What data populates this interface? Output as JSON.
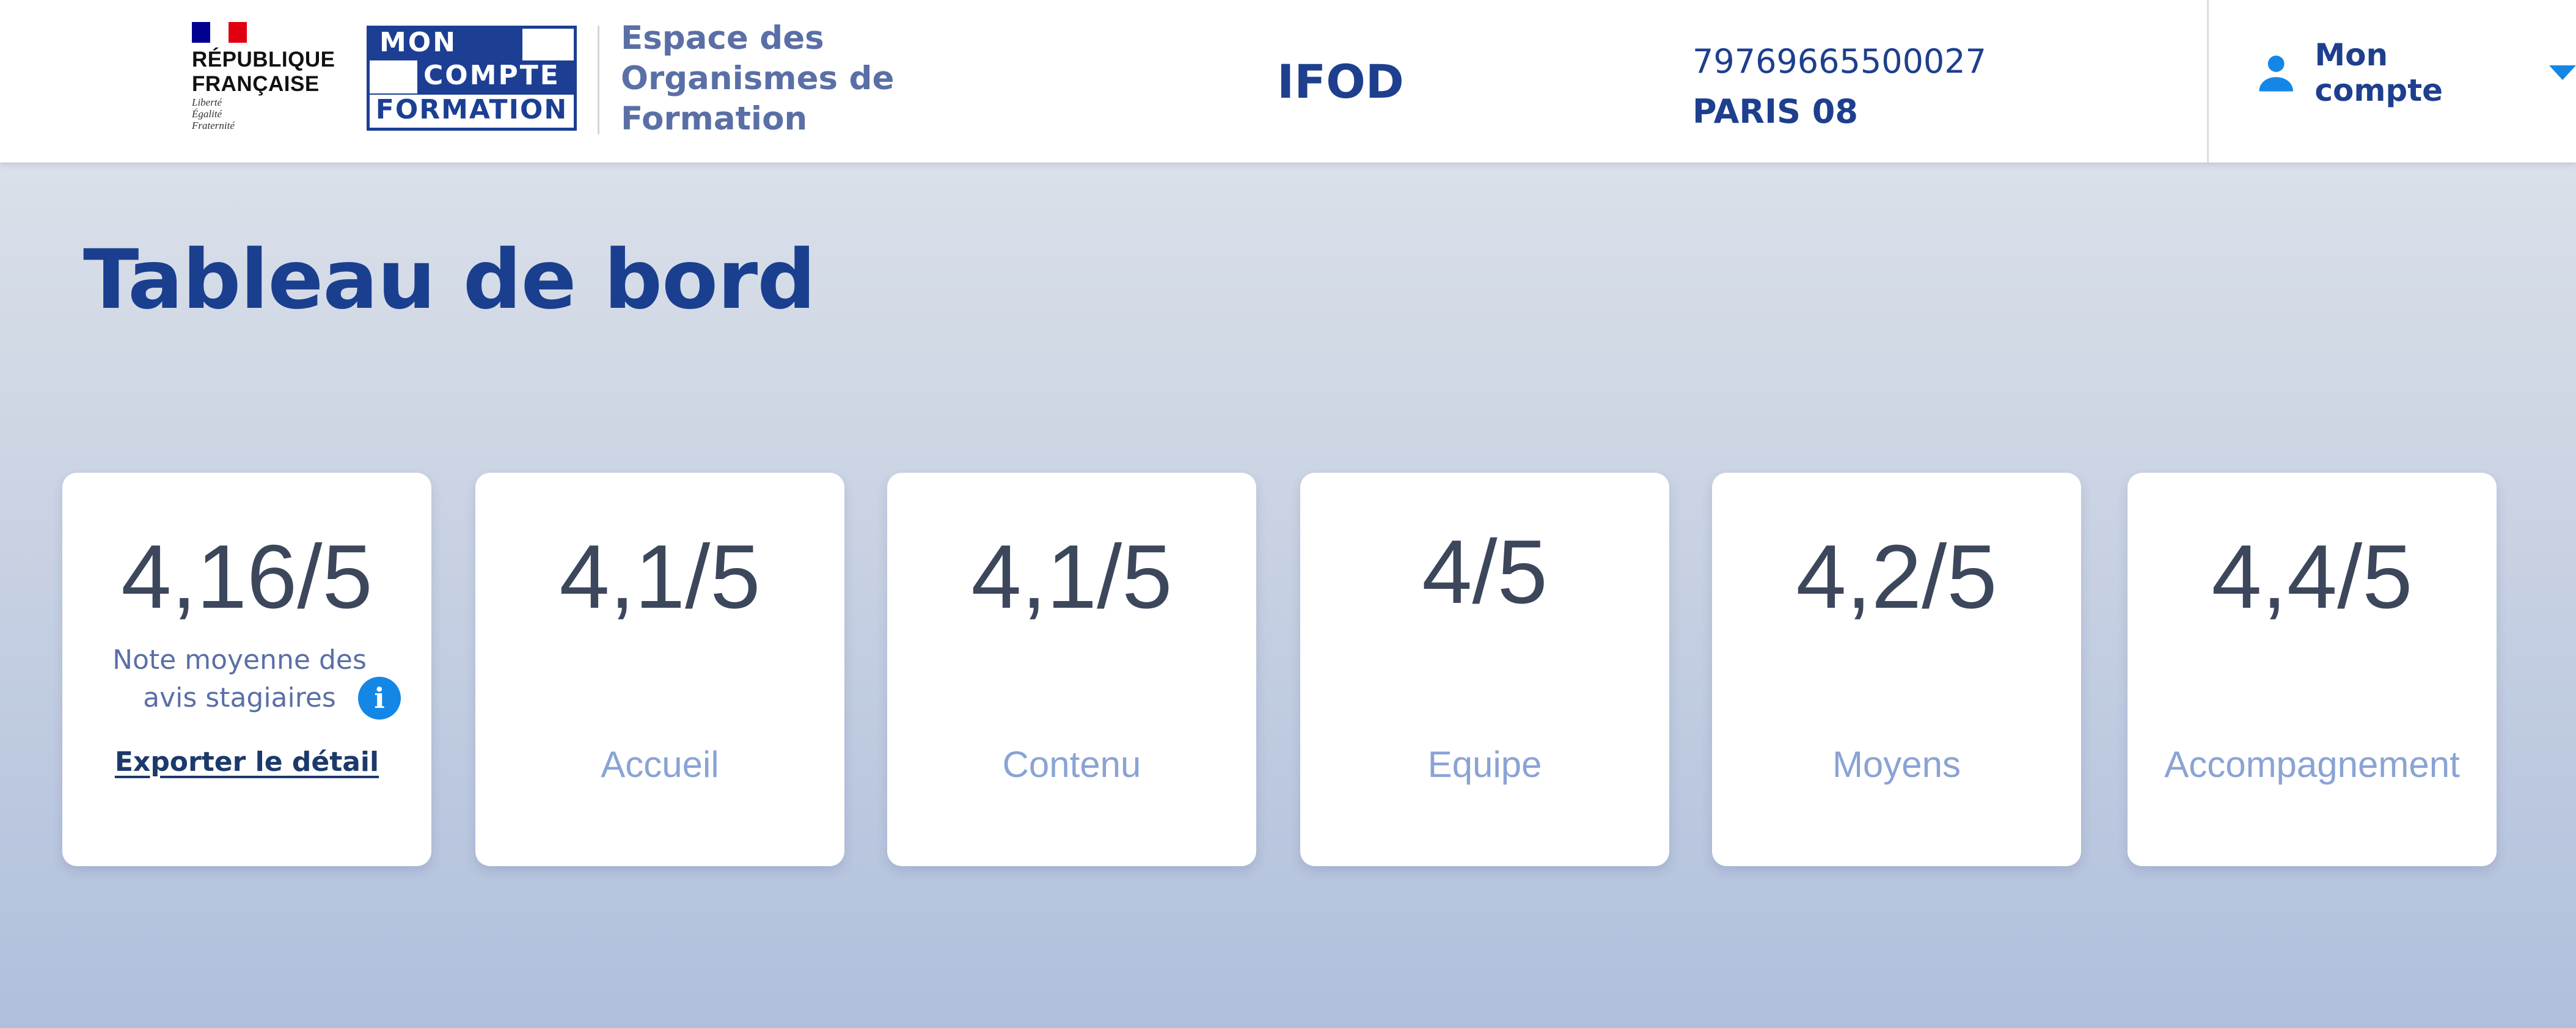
{
  "header": {
    "republic_name": "RÉPUBLIQUE\nFRANÇAISE",
    "republic_motto": "Liberté\nÉgalité\nFraternité",
    "mcf_logo": [
      "MON",
      "COMPTE",
      "FORMATION"
    ],
    "space_title": "Espace des Organismes de Formation",
    "organisation": "IFOD",
    "siret": "79769665500027",
    "city": "PARIS 08",
    "account_label": "Mon compte",
    "colors": {
      "brand_blue": "#1c3f94",
      "accent_blue": "#1487e6"
    }
  },
  "main": {
    "title": "Tableau de bord",
    "summary": {
      "score": "4,16/5",
      "label": "Note moyenne des avis stagiaires",
      "info_icon": "info-icon",
      "export_label": "Exporter le détail"
    },
    "ratings": [
      {
        "score": "4,1/5",
        "label": "Accueil"
      },
      {
        "score": "4,1/5",
        "label": "Contenu"
      },
      {
        "score": "4/5",
        "label": "Equipe"
      },
      {
        "score": "4,2/5",
        "label": "Moyens"
      },
      {
        "score": "4,4/5",
        "label": "Accompagnement"
      }
    ]
  }
}
